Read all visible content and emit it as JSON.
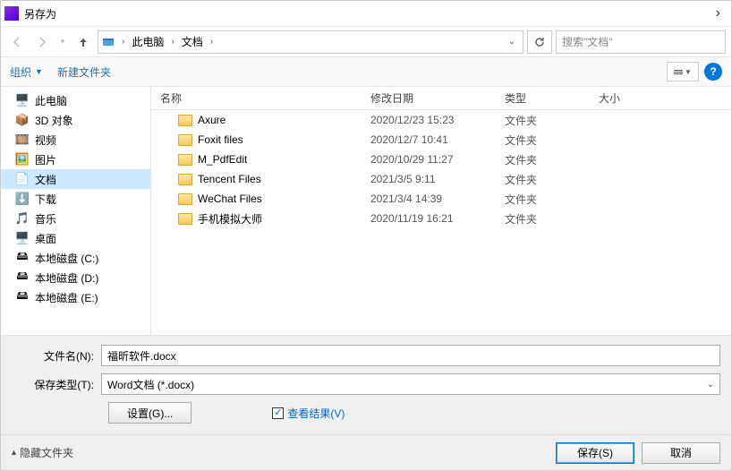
{
  "window": {
    "title": "另存为"
  },
  "nav": {
    "path_root": "此电脑",
    "path_folder": "文档",
    "search_placeholder": "搜索\"文档\""
  },
  "toolbar": {
    "organize": "组织",
    "new_folder": "新建文件夹"
  },
  "sidebar": {
    "items": [
      {
        "label": "此电脑",
        "icon": "🖥️"
      },
      {
        "label": "3D 对象",
        "icon": "📦"
      },
      {
        "label": "视频",
        "icon": "🎞️"
      },
      {
        "label": "图片",
        "icon": "🖼️"
      },
      {
        "label": "文档",
        "icon": "📄",
        "selected": true
      },
      {
        "label": "下载",
        "icon": "⬇️"
      },
      {
        "label": "音乐",
        "icon": "🎵"
      },
      {
        "label": "桌面",
        "icon": "🖥️"
      },
      {
        "label": "本地磁盘 (C:)",
        "icon": "🖴"
      },
      {
        "label": "本地磁盘 (D:)",
        "icon": "🖴"
      },
      {
        "label": "本地磁盘 (E:)",
        "icon": "🖴"
      }
    ]
  },
  "columns": {
    "name": "名称",
    "date": "修改日期",
    "type": "类型",
    "size": "大小"
  },
  "files": [
    {
      "name": "Axure",
      "date": "2020/12/23 15:23",
      "type": "文件夹"
    },
    {
      "name": "Foxit files",
      "date": "2020/12/7 10:41",
      "type": "文件夹"
    },
    {
      "name": "M_PdfEdit",
      "date": "2020/10/29 11:27",
      "type": "文件夹"
    },
    {
      "name": "Tencent Files",
      "date": "2021/3/5 9:11",
      "type": "文件夹"
    },
    {
      "name": "WeChat Files",
      "date": "2021/3/4 14:39",
      "type": "文件夹"
    },
    {
      "name": "手机模拟大师",
      "date": "2020/11/19 16:21",
      "type": "文件夹"
    }
  ],
  "form": {
    "filename_label": "文件名(N):",
    "filename_value": "福昕软件.docx",
    "filetype_label": "保存类型(T):",
    "filetype_value": "Word文档 (*.docx)",
    "settings_btn": "设置(G)...",
    "view_results": "查看结果(V)"
  },
  "footer": {
    "hide_folders": "隐藏文件夹",
    "save": "保存(S)",
    "cancel": "取消"
  }
}
